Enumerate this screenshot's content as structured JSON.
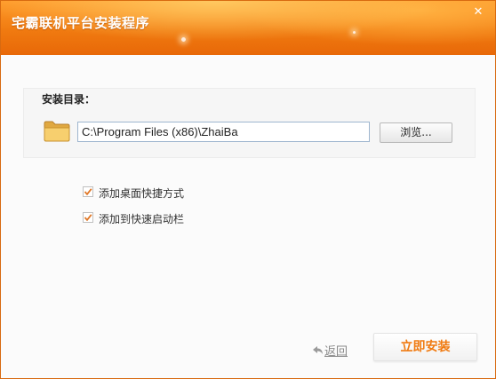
{
  "window": {
    "title": "宅霸联机平台安装程序",
    "close_glyph": "✕"
  },
  "install": {
    "dir_label": "安装目录：",
    "path_value": "C:\\Program Files (x86)\\ZhaiBa",
    "browse_label": "浏览..."
  },
  "options": [
    {
      "label": "添加桌面快捷方式",
      "checked": true
    },
    {
      "label": "添加到快速启动栏",
      "checked": true
    }
  ],
  "footer": {
    "back_label": "返回",
    "install_label": "立即安装"
  },
  "colors": {
    "accent": "#f07a10",
    "check": "#e07828"
  }
}
